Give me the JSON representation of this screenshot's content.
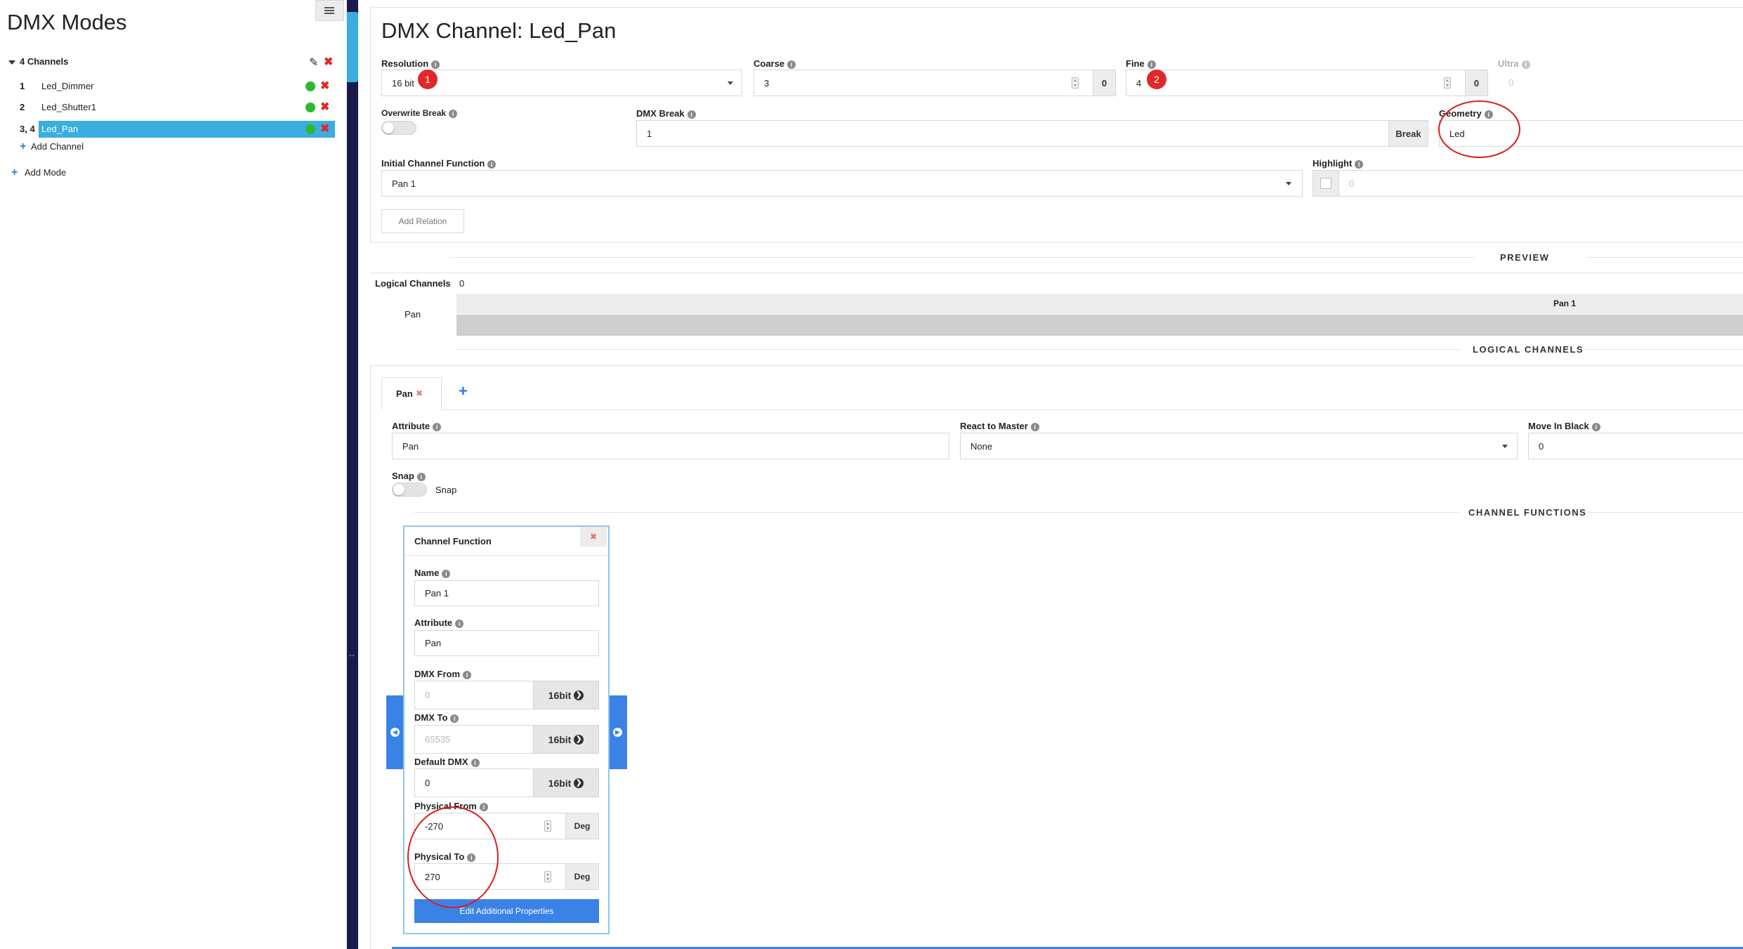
{
  "sidebar": {
    "title": "DMX Modes",
    "menu_icon": "hamburger-icon",
    "mode_header": "4 Channels",
    "channels": [
      {
        "num": "1",
        "name": "Led_Dimmer"
      },
      {
        "num": "2",
        "name": "Led_Shutter1"
      },
      {
        "num": "3, 4",
        "name": "Led_Pan"
      }
    ],
    "add_channel": "Add Channel",
    "add_mode": "Add Mode",
    "colors": {
      "active": "#3aaee0",
      "dot": "#2eb82e",
      "delete": "#e02828",
      "divider": "#1a1a4a"
    }
  },
  "channel": {
    "title": "DMX Channel: Led_Pan",
    "resolution": {
      "label": "Resolution",
      "value": "16 bit"
    },
    "coarse": {
      "label": "Coarse",
      "value": "3",
      "addon": "0"
    },
    "fine": {
      "label": "Fine",
      "value": "4",
      "addon": "0"
    },
    "ultra": {
      "label": "Ultra",
      "value": "0"
    },
    "overwrite_break": {
      "label": "Overwrite Break"
    },
    "dmx_break": {
      "label": "DMX Break",
      "value": "1",
      "addon": "Break"
    },
    "geometry": {
      "label": "Geometry",
      "value": "Led"
    },
    "initial_function": {
      "label": "Initial Channel Function",
      "value": "Pan 1"
    },
    "highlight": {
      "label": "Highlight",
      "value": "0"
    },
    "add_relation": "Add Relation",
    "badges": [
      "1",
      "2"
    ]
  },
  "preview": {
    "section": "PREVIEW",
    "logical_label": "Logical Channels",
    "logical_value": "0",
    "row_name": "Pan",
    "bar_label": "Pan 1"
  },
  "logical": {
    "section": "LOGICAL CHANNELS",
    "tab": "Pan",
    "add_tab": "+",
    "attribute": {
      "label": "Attribute",
      "value": "Pan"
    },
    "react_master": {
      "label": "React to Master",
      "value": "None"
    },
    "move_black": {
      "label": "Move In Black",
      "value": "0"
    },
    "snap": {
      "label": "Snap",
      "toggle_label": "Snap"
    }
  },
  "functions": {
    "section": "CHANNEL FUNCTIONS",
    "card_title": "Channel Function",
    "name": {
      "label": "Name",
      "value": "Pan 1"
    },
    "attribute": {
      "label": "Attribute",
      "value": "Pan"
    },
    "dmx_from": {
      "label": "DMX From",
      "value": "0",
      "unit": "16bit"
    },
    "dmx_to": {
      "label": "DMX To",
      "value": "65535",
      "unit": "16bit"
    },
    "default_dmx": {
      "label": "Default DMX",
      "value": "0",
      "unit": "16bit"
    },
    "physical_from": {
      "label": "Physical From",
      "value": "-270",
      "unit": "Deg"
    },
    "physical_to": {
      "label": "Physical To",
      "value": "270",
      "unit": "Deg"
    },
    "edit_button": "Edit Additional Properties"
  }
}
